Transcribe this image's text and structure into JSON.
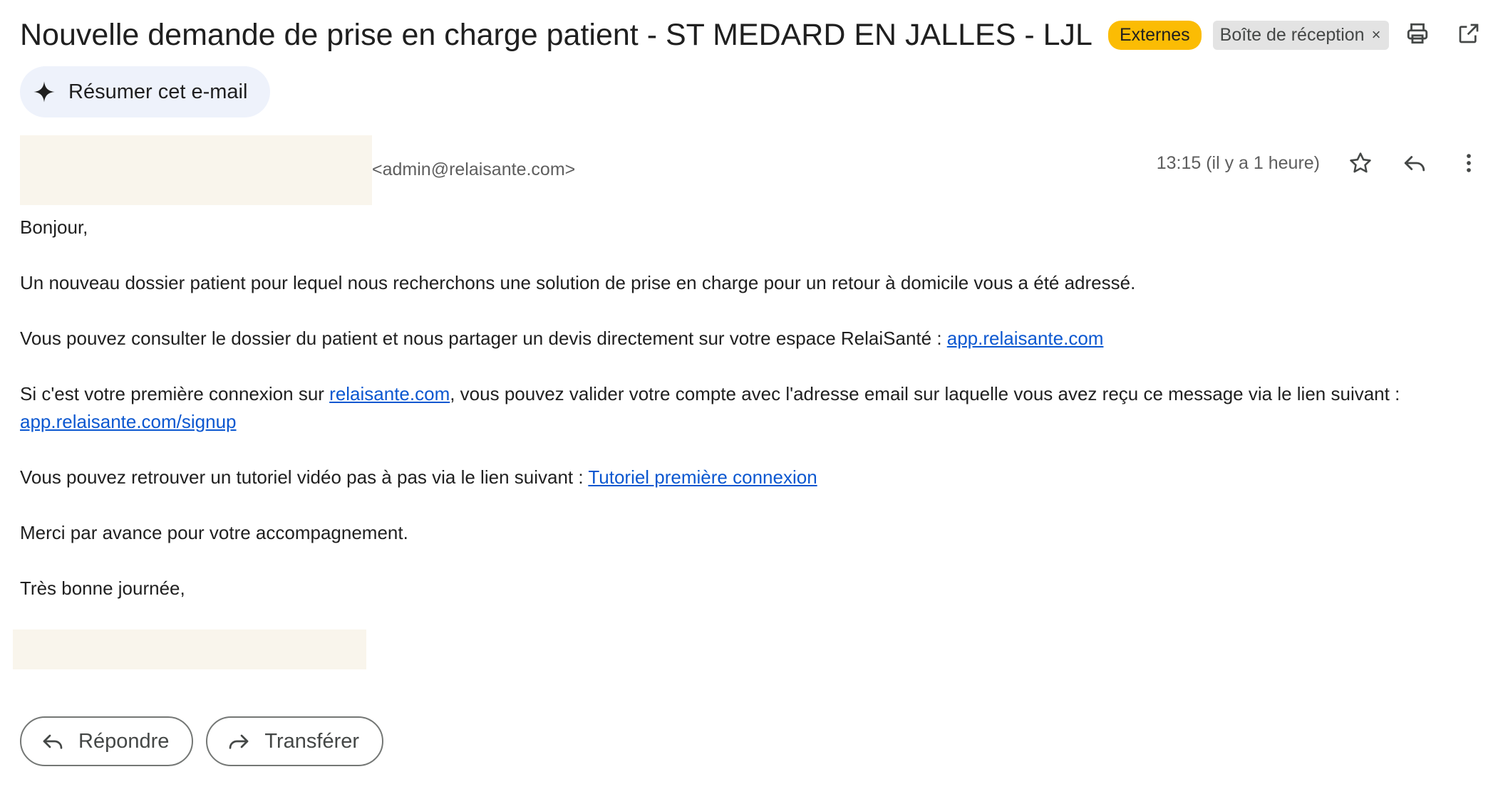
{
  "header": {
    "subject": "Nouvelle demande de prise en charge patient - ST MEDARD EN JALLES - LJL",
    "label_external": "Externes",
    "label_inbox": "Boîte de réception",
    "label_remove": "×"
  },
  "summarize": {
    "label": "Résumer cet e-mail",
    "icon": "sparkle-icon"
  },
  "sender": {
    "email": "<admin@relaisante.com>",
    "time": "13:15 (il y a 1 heure)"
  },
  "body": {
    "greeting": "Bonjour,",
    "p1": "Un nouveau dossier patient pour lequel nous recherchons une solution de prise en charge pour un retour à domicile vous a été adressé.",
    "p2_text": "Vous pouvez consulter le dossier du patient et nous partager un devis directement sur votre espace RelaiSanté : ",
    "p2_link": "app.relaisante.com",
    "p3_text1": "Si c'est votre première connexion sur ",
    "p3_link1": "relaisante.com",
    "p3_text2": ", vous pouvez valider votre compte avec l'adresse email sur laquelle vous avez reçu ce message via le lien suivant :",
    "p3_link2": "app.relaisante.com/signup",
    "p4_text": "Vous pouvez retrouver un tutoriel vidéo pas à pas via le lien suivant : ",
    "p4_link": "Tutoriel première connexion",
    "p5": "Merci par avance pour votre accompagnement.",
    "p6": "Très bonne journée,"
  },
  "actions": {
    "reply_label": "Répondre",
    "forward_label": "Transférer"
  },
  "colors": {
    "label_external_bg": "#fbbc04",
    "link": "#0b57d0",
    "summarize_bg": "#eef2fb",
    "redaction": "#f9f5ec"
  }
}
